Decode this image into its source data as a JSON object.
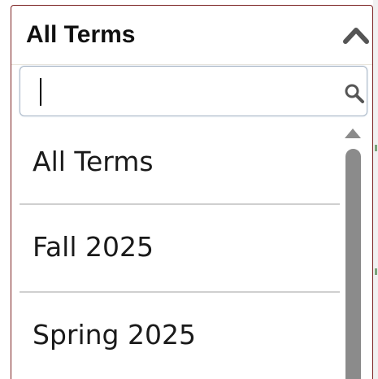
{
  "dropdown": {
    "selected_label": "All Terms",
    "search": {
      "value": "",
      "placeholder": ""
    },
    "options": [
      {
        "label": "All Terms"
      },
      {
        "label": "Fall 2025"
      },
      {
        "label": "Spring 2025"
      }
    ]
  },
  "icons": {
    "collapse": "chevron-up-icon",
    "search": "search-icon",
    "scroll_up": "scroll-up-arrow-icon"
  },
  "colors": {
    "border_accent": "#7a1f1f",
    "search_border": "#aab8c8",
    "divider": "#cfcfcf",
    "scrollbar_thumb": "#8b8b8b",
    "icon": "#555555"
  }
}
